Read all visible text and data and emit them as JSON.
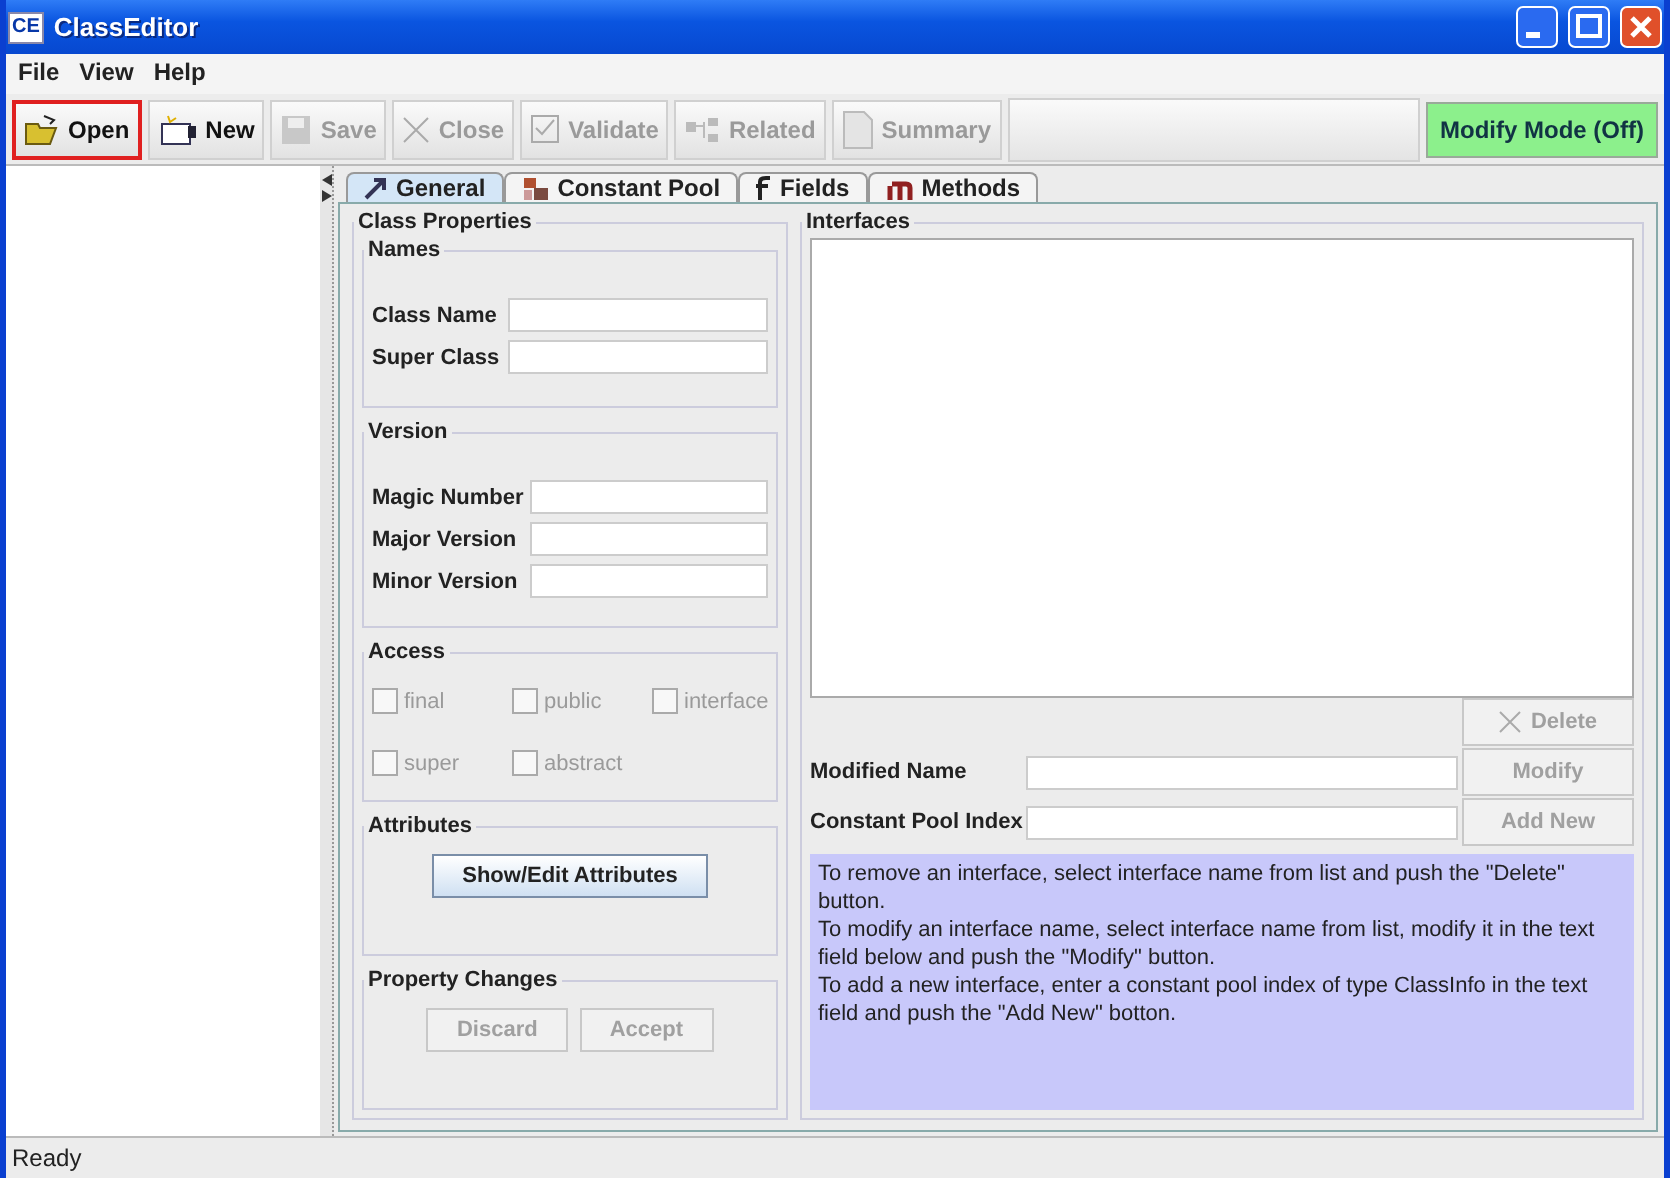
{
  "window": {
    "app_icon": "CE",
    "title": "ClassEditor"
  },
  "menu": [
    "File",
    "View",
    "Help"
  ],
  "toolbar": [
    {
      "label": "Open",
      "kind": "open",
      "disabled": false,
      "highlighted": true
    },
    {
      "label": "New",
      "kind": "new",
      "disabled": false,
      "highlighted": false
    },
    {
      "label": "Save",
      "kind": "save",
      "disabled": true,
      "highlighted": false
    },
    {
      "label": "Close",
      "kind": "close",
      "disabled": true,
      "highlighted": false
    },
    {
      "label": "Validate",
      "kind": "validate",
      "disabled": true,
      "highlighted": false
    },
    {
      "label": "Related",
      "kind": "related",
      "disabled": true,
      "highlighted": false
    },
    {
      "label": "Summary",
      "kind": "summary",
      "disabled": true,
      "highlighted": false
    }
  ],
  "mode_button": "Modify Mode (Off)",
  "tabs": [
    {
      "label": "General",
      "kind": "general",
      "selected": true
    },
    {
      "label": "Constant Pool",
      "kind": "pool",
      "selected": false
    },
    {
      "label": "Fields",
      "kind": "fields",
      "selected": false
    },
    {
      "label": "Methods",
      "kind": "methods",
      "selected": false
    }
  ],
  "class_properties": {
    "title": "Class Properties",
    "names": {
      "title": "Names",
      "fields": [
        {
          "label": "Class Name"
        },
        {
          "label": "Super Class"
        }
      ]
    },
    "version": {
      "title": "Version",
      "fields": [
        {
          "label": "Magic Number"
        },
        {
          "label": "Major Version"
        },
        {
          "label": "Minor Version"
        }
      ]
    },
    "access": {
      "title": "Access",
      "checkboxes": [
        {
          "label": "final",
          "checked": false,
          "disabled": true
        },
        {
          "label": "public",
          "checked": false,
          "disabled": true
        },
        {
          "label": "interface",
          "checked": false,
          "disabled": true
        },
        {
          "label": "super",
          "checked": false,
          "disabled": true
        },
        {
          "label": "abstract",
          "checked": false,
          "disabled": true
        }
      ]
    },
    "attributes": {
      "title": "Attributes",
      "button": "Show/Edit Attributes"
    },
    "property_changes": {
      "title": "Property Changes",
      "buttons": [
        {
          "label": "Discard",
          "disabled": true
        },
        {
          "label": "Accept",
          "disabled": true
        }
      ]
    }
  },
  "interfaces": {
    "title": "Interfaces",
    "delete_button": {
      "label": "Delete",
      "disabled": true
    },
    "fields": [
      {
        "label": "Modified Name",
        "button": "Modify",
        "disabled": true
      },
      {
        "label": "Constant Pool Index",
        "button": "Add New",
        "disabled": true
      }
    ],
    "help": [
      "To remove an interface, select interface name from list and push the \"Delete\" button.",
      "To modify an interface name, select interface name from list, modify it in the text field below and push the \"Modify\" button.",
      "To add a new interface, enter a constant pool index of type ClassInfo in the text field and push the \"Add New\" botton."
    ]
  },
  "status_bar": "Ready"
}
